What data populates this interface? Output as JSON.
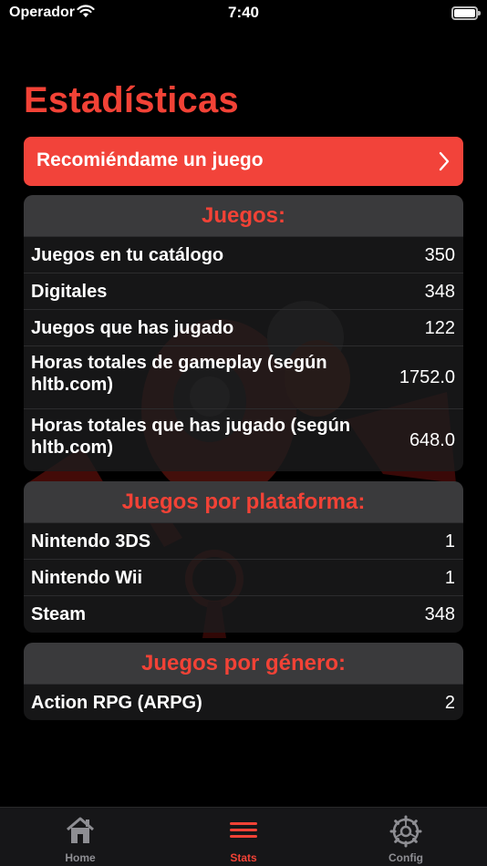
{
  "status_bar": {
    "carrier": "Operador",
    "time": "7:40"
  },
  "title": "Estadísticas",
  "recommend_button": {
    "label": "Recomiéndame un juego"
  },
  "juegos": {
    "header": "Juegos:",
    "rows": [
      {
        "label": "Juegos en tu catálogo",
        "value": "350"
      },
      {
        "label": "Digitales",
        "value": "348"
      },
      {
        "label": "Juegos que has jugado",
        "value": "122"
      },
      {
        "label": "Horas totales de gameplay (según hltb.com)",
        "value": "1752.0"
      },
      {
        "label": "Horas totales que has jugado (según hltb.com)",
        "value": "648.0"
      }
    ]
  },
  "plataforma": {
    "header": "Juegos por plataforma:",
    "rows": [
      {
        "label": "Nintendo 3DS",
        "value": "1"
      },
      {
        "label": "Nintendo Wii",
        "value": "1"
      },
      {
        "label": "Steam",
        "value": "348"
      }
    ]
  },
  "genero": {
    "header": "Juegos por género:",
    "rows": [
      {
        "label": "Action RPG (ARPG)",
        "value": "2"
      }
    ]
  },
  "tab_bar": {
    "tabs": [
      {
        "label": "Home",
        "icon": "home-icon"
      },
      {
        "label": "Stats",
        "icon": "stats-icon"
      },
      {
        "label": "Config",
        "icon": "gear-icon"
      }
    ],
    "active": "Stats"
  },
  "colors": {
    "accent": "#f24236",
    "card": "#1c1c1e",
    "header": "#3a3a3c"
  }
}
